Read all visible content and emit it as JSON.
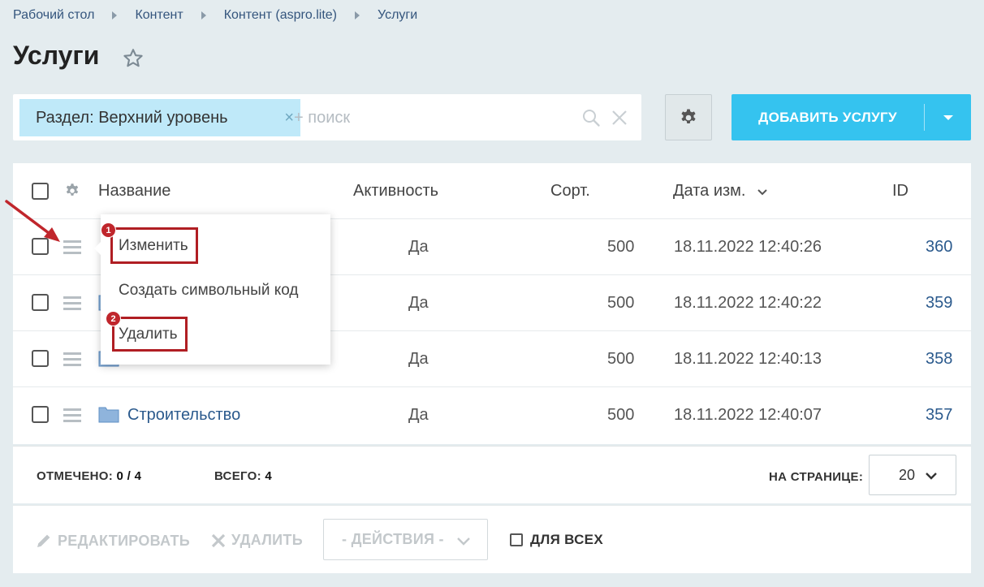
{
  "breadcrumb": [
    "Рабочий стол",
    "Контент",
    "Контент (aspro.lite)",
    "Услуги"
  ],
  "page": {
    "title": "Услуги"
  },
  "filter": {
    "chip_label": "Раздел: Верхний уровень",
    "chip_close": "×",
    "search_placeholder": "+ поиск"
  },
  "toolbar": {
    "add_label": "ДОБАВИТЬ УСЛУГУ"
  },
  "table": {
    "headers": {
      "name": "Название",
      "active": "Активность",
      "sort": "Сорт.",
      "date": "Дата изм.",
      "id": "ID"
    },
    "rows": [
      {
        "name": "",
        "active": "Да",
        "sort": "500",
        "date": "18.11.2022 12:40:26",
        "id": "360"
      },
      {
        "name": "",
        "active": "Да",
        "sort": "500",
        "date": "18.11.2022 12:40:22",
        "id": "359"
      },
      {
        "name": "",
        "active": "Да",
        "sort": "500",
        "date": "18.11.2022 12:40:13",
        "id": "358"
      },
      {
        "name": "Строительство",
        "active": "Да",
        "sort": "500",
        "date": "18.11.2022 12:40:07",
        "id": "357"
      }
    ]
  },
  "footer": {
    "checked_label": "ОТМЕЧЕНО:",
    "checked_value": "0 / 4",
    "total_label": "ВСЕГО:",
    "total_value": "4",
    "perpage_label": "НА СТРАНИЦЕ:",
    "perpage_value": "20"
  },
  "actions": {
    "edit_label": "РЕДАКТИРОВАТЬ",
    "delete_label": "УДАЛИТЬ",
    "select_label": "- ДЕЙСТВИЯ -",
    "for_all_label": "ДЛЯ ВСЕХ"
  },
  "context_menu": {
    "items": [
      "Изменить",
      "Создать символьный код",
      "Удалить"
    ],
    "badges": [
      "1",
      "2"
    ]
  },
  "colors": {
    "accent": "#35c3ef",
    "chip_bg": "#bfe9f9",
    "link": "#2b5a8d",
    "highlight": "#b01e23"
  }
}
